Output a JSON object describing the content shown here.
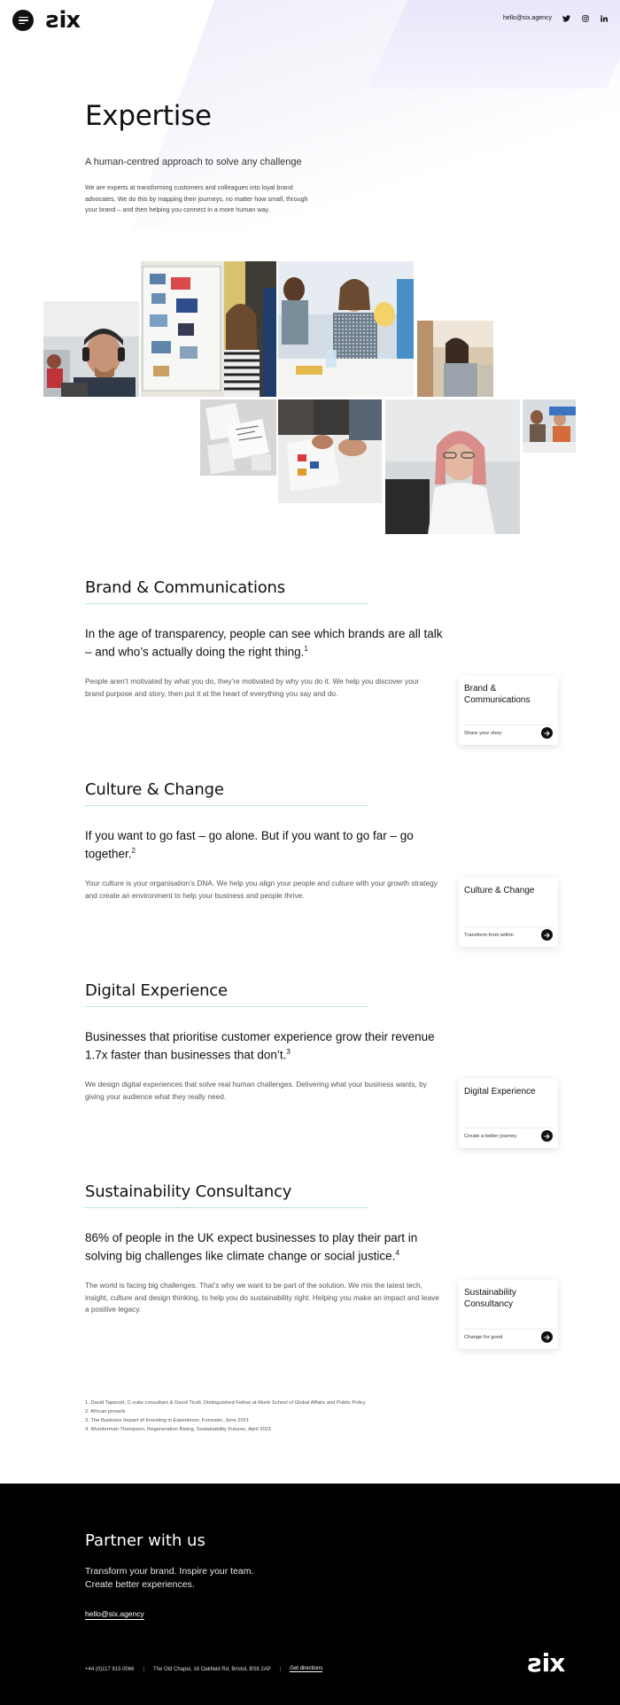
{
  "header": {
    "logo_text": "six",
    "email": "hello@six.agency",
    "icons": [
      "menu-icon",
      "twitter-icon",
      "instagram-icon",
      "linkedin-icon"
    ]
  },
  "hero": {
    "title": "Expertise",
    "subtitle": "A human-centred approach to solve any challenge",
    "body": "We are experts at transforming customers and colleagues into loyal brand advocates. We do this by mapping their journeys, no matter how small, through your brand – and then helping you connect in a more human way."
  },
  "sections": [
    {
      "title": "Brand & Communications",
      "quote": "In the age of transparency, people can see which brands are all talk – and who’s actually doing the right thing.",
      "footnote_ref": "1",
      "body": "People aren’t motivated by what you do, they’re motivated by why you do it. We help you discover your brand purpose and story, then put it at the heart of everything you say and do.",
      "card_title": "Brand & Communications",
      "card_cta": "Share your story"
    },
    {
      "title": "Culture & Change",
      "quote": "If you want to go fast – go alone. But if you want to go far – go together.",
      "footnote_ref": "2",
      "body": "Your culture is your organisation’s DNA. We help you align your people and culture with your growth strategy and create an environment to help your business and people thrive.",
      "card_title": "Culture & Change",
      "card_cta": "Transform from within"
    },
    {
      "title": "Digital Experience",
      "quote": "Businesses that prioritise customer experience grow their revenue 1.7x faster than businesses that don’t.",
      "footnote_ref": "3",
      "body": "We design digital experiences that solve real human challenges. Delivering what your business wants, by giving your audience what they really need.",
      "card_title": "Digital Experience",
      "card_cta": "Create a better journey"
    },
    {
      "title": "Sustainability Consultancy",
      "quote": "86% of people in the UK expect businesses to play their part in solving big challenges like climate change or social justice.",
      "footnote_ref": "4",
      "body": "The world is facing big challenges. That’s why we want to be part of the solution. We mix the latest tech, insight, culture and design thinking, to help you do sustainability right. Helping you make an impact and leave a positive legacy.",
      "card_title": "Sustainability Consultancy",
      "card_cta": "Change for good"
    }
  ],
  "footnotes": [
    "1.   David Tapscott, C-suite consultant & David Ticoll, Distinguished Fellow at Munk School of Global Affairs and Public Policy",
    "2.   African proverb",
    "3.   The Business Impact of Investing in Experience: Forrester, June 2021",
    "4.   Wunderman Thompson, Regeneration Rising, Sustainability Futures, April 2021"
  ],
  "footer": {
    "title": "Partner with us",
    "tagline_1": "Transform your brand. Inspire your team.",
    "tagline_2": "Create better experiences.",
    "email": "hello@six.agency",
    "phone": "+44 (0)117 915 0066",
    "address": "The Old Chapel, 16 Oakfield Rd, Bristol, BS8 2AP",
    "directions_label": "Get directions",
    "separator": "|",
    "logo_text": "six"
  },
  "colors": {
    "accent_rule": "#bfe7df",
    "footer_bg": "#000000",
    "header_tint": "#e8e4fa"
  }
}
